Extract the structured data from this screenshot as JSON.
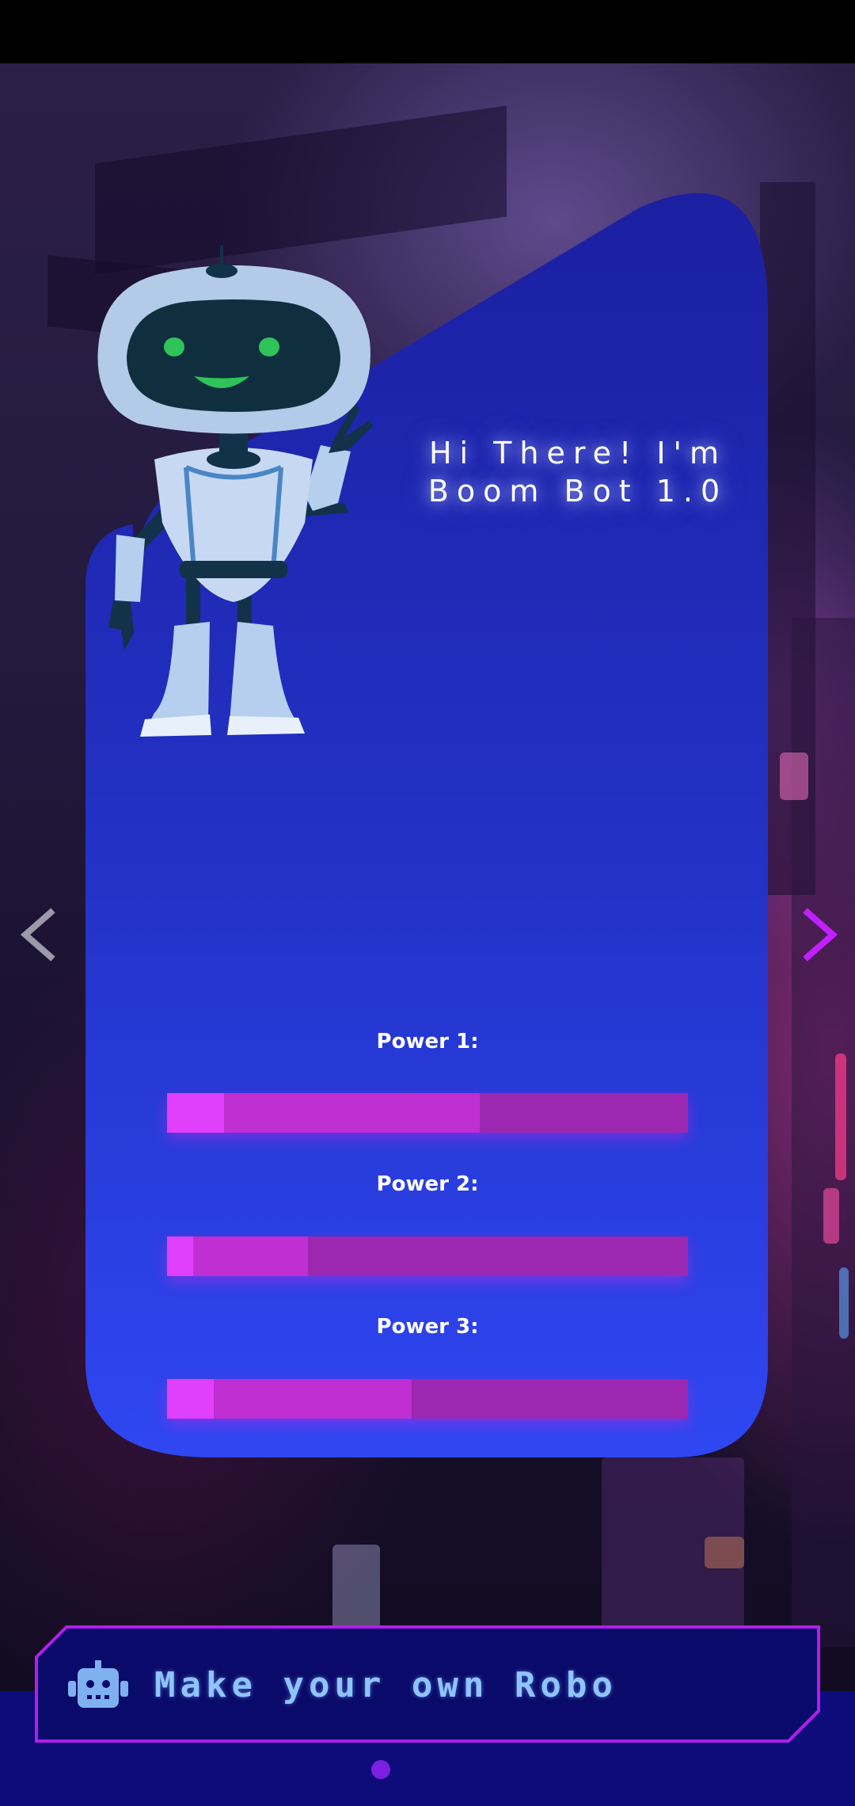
{
  "greeting": {
    "line1": "Hi There! I'm",
    "line2": "Boom Bot 1.0"
  },
  "powers": [
    {
      "label": "Power 1:",
      "value": 0.11,
      "secondary": 0.6
    },
    {
      "label": "Power 2:",
      "value": 0.05,
      "secondary": 0.27
    },
    {
      "label": "Power 3:",
      "value": 0.09,
      "secondary": 0.47
    }
  ],
  "cta": {
    "label": "Make your own Robo",
    "icon": "robot-icon"
  },
  "navigation": {
    "prev_icon": "chevron-left-icon",
    "next_icon": "chevron-right-icon"
  },
  "pager": {
    "current": 1,
    "total": 1
  },
  "colors": {
    "bar_track": "#9c27b0",
    "bar_secondary": "#bf2fd1",
    "bar_primary": "#e040fb",
    "cta_border": "#b21fe8",
    "cta_text": "#8fc4ff",
    "accent_arrow": "#c020ff"
  }
}
